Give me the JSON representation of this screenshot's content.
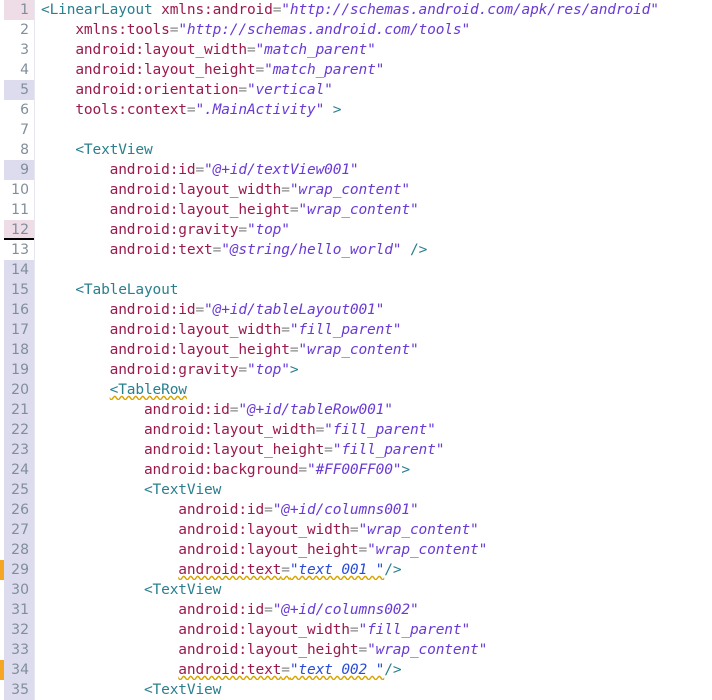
{
  "editor": {
    "kind": "xml-code-editor",
    "language": "android-xml-layout",
    "total_visible_lines": 35,
    "colors": {
      "background": "#ffffff",
      "tag": "#2a7f8f",
      "attribute": "#9b1a4e",
      "string": "#6a3bd4",
      "string_literal": "#2a4bd8",
      "equals": "#8a8a8a",
      "gutter_text": "#808e9b",
      "gutter_modified": "#dcdcee",
      "gutter_marked": "#eedce6",
      "warning_underline": "#d7a400",
      "warning_marker": "#f5a623",
      "caret_line_border": "#000000"
    }
  },
  "lines": [
    {
      "num": "1",
      "gutter": "marked",
      "marker": false,
      "indent": 0,
      "tokens": [
        {
          "type": "tag",
          "text": "<LinearLayout"
        },
        {
          "type": "plain",
          "text": " "
        },
        {
          "type": "attr",
          "text": "xmlns:android"
        },
        {
          "type": "eq",
          "text": "="
        },
        {
          "type": "str",
          "text": "\"http://schemas.android.com/apk/res/android\""
        }
      ]
    },
    {
      "num": "2",
      "gutter": "none",
      "marker": false,
      "indent": 4,
      "tokens": [
        {
          "type": "attr",
          "text": "xmlns:tools"
        },
        {
          "type": "eq",
          "text": "="
        },
        {
          "type": "str",
          "text": "\"http://schemas.android.com/tools\""
        }
      ]
    },
    {
      "num": "3",
      "gutter": "none",
      "marker": false,
      "indent": 4,
      "tokens": [
        {
          "type": "attr",
          "text": "android:layout_width"
        },
        {
          "type": "eq",
          "text": "="
        },
        {
          "type": "str",
          "text": "\"match_parent\""
        }
      ]
    },
    {
      "num": "4",
      "gutter": "none",
      "marker": false,
      "indent": 4,
      "tokens": [
        {
          "type": "attr",
          "text": "android:layout_height"
        },
        {
          "type": "eq",
          "text": "="
        },
        {
          "type": "str",
          "text": "\"match_parent\""
        }
      ]
    },
    {
      "num": "5",
      "gutter": "mod",
      "marker": false,
      "indent": 4,
      "tokens": [
        {
          "type": "attr",
          "text": "android:orientation"
        },
        {
          "type": "eq",
          "text": "="
        },
        {
          "type": "str",
          "text": "\"vertical\""
        }
      ]
    },
    {
      "num": "6",
      "gutter": "none",
      "marker": false,
      "indent": 4,
      "tokens": [
        {
          "type": "attr",
          "text": "tools:context"
        },
        {
          "type": "eq",
          "text": "="
        },
        {
          "type": "str",
          "text": "\".MainActivity\""
        },
        {
          "type": "plain",
          "text": " "
        },
        {
          "type": "tag",
          "text": ">"
        }
      ]
    },
    {
      "num": "7",
      "gutter": "none",
      "marker": false,
      "indent": 0,
      "tokens": []
    },
    {
      "num": "8",
      "gutter": "none",
      "marker": false,
      "indent": 4,
      "tokens": [
        {
          "type": "tag",
          "text": "<TextView"
        }
      ]
    },
    {
      "num": "9",
      "gutter": "mod",
      "marker": false,
      "indent": 8,
      "tokens": [
        {
          "type": "attr",
          "text": "android:id"
        },
        {
          "type": "eq",
          "text": "="
        },
        {
          "type": "str",
          "text": "\"@+id/textView001\""
        }
      ]
    },
    {
      "num": "10",
      "gutter": "none",
      "marker": false,
      "indent": 8,
      "tokens": [
        {
          "type": "attr",
          "text": "android:layout_width"
        },
        {
          "type": "eq",
          "text": "="
        },
        {
          "type": "str",
          "text": "\"wrap_content\""
        }
      ]
    },
    {
      "num": "11",
      "gutter": "none",
      "marker": false,
      "indent": 8,
      "tokens": [
        {
          "type": "attr",
          "text": "android:layout_height"
        },
        {
          "type": "eq",
          "text": "="
        },
        {
          "type": "str",
          "text": "\"wrap_content\""
        }
      ]
    },
    {
      "num": "12",
      "gutter": "marked",
      "caret": true,
      "marker": false,
      "indent": 8,
      "tokens": [
        {
          "type": "attr",
          "text": "android:gravity"
        },
        {
          "type": "eq",
          "text": "="
        },
        {
          "type": "str",
          "text": "\"top\""
        }
      ]
    },
    {
      "num": "13",
      "gutter": "none",
      "marker": false,
      "indent": 8,
      "tokens": [
        {
          "type": "attr",
          "text": "android:text"
        },
        {
          "type": "eq",
          "text": "="
        },
        {
          "type": "str",
          "text": "\"@string/hello_world\""
        },
        {
          "type": "plain",
          "text": " "
        },
        {
          "type": "tag",
          "text": "/>"
        }
      ]
    },
    {
      "num": "14",
      "gutter": "mod",
      "marker": false,
      "indent": 0,
      "tokens": []
    },
    {
      "num": "15",
      "gutter": "mod",
      "marker": false,
      "indent": 4,
      "tokens": [
        {
          "type": "tag",
          "text": "<TableLayout"
        }
      ]
    },
    {
      "num": "16",
      "gutter": "mod",
      "marker": false,
      "indent": 8,
      "tokens": [
        {
          "type": "attr",
          "text": "android:id"
        },
        {
          "type": "eq",
          "text": "="
        },
        {
          "type": "str",
          "text": "\"@+id/tableLayout001\""
        }
      ]
    },
    {
      "num": "17",
      "gutter": "mod",
      "marker": false,
      "indent": 8,
      "tokens": [
        {
          "type": "attr",
          "text": "android:layout_width"
        },
        {
          "type": "eq",
          "text": "="
        },
        {
          "type": "str",
          "text": "\"fill_parent\""
        }
      ]
    },
    {
      "num": "18",
      "gutter": "mod",
      "marker": false,
      "indent": 8,
      "tokens": [
        {
          "type": "attr",
          "text": "android:layout_height"
        },
        {
          "type": "eq",
          "text": "="
        },
        {
          "type": "str",
          "text": "\"wrap_content\""
        }
      ]
    },
    {
      "num": "19",
      "gutter": "mod",
      "marker": false,
      "indent": 8,
      "tokens": [
        {
          "type": "attr",
          "text": "android:gravity"
        },
        {
          "type": "eq",
          "text": "="
        },
        {
          "type": "str",
          "text": "\"top\""
        },
        {
          "type": "tag",
          "text": ">"
        }
      ]
    },
    {
      "num": "20",
      "gutter": "mod",
      "marker": false,
      "indent": 8,
      "tokens": [
        {
          "type": "tag-warn",
          "text": "<TableRow"
        }
      ]
    },
    {
      "num": "21",
      "gutter": "mod",
      "marker": false,
      "indent": 12,
      "tokens": [
        {
          "type": "attr",
          "text": "android:id"
        },
        {
          "type": "eq",
          "text": "="
        },
        {
          "type": "str",
          "text": "\"@+id/tableRow001\""
        }
      ]
    },
    {
      "num": "22",
      "gutter": "mod",
      "marker": false,
      "indent": 12,
      "tokens": [
        {
          "type": "attr",
          "text": "android:layout_width"
        },
        {
          "type": "eq",
          "text": "="
        },
        {
          "type": "str",
          "text": "\"fill_parent\""
        }
      ]
    },
    {
      "num": "23",
      "gutter": "mod",
      "marker": false,
      "indent": 12,
      "tokens": [
        {
          "type": "attr",
          "text": "android:layout_height"
        },
        {
          "type": "eq",
          "text": "="
        },
        {
          "type": "str",
          "text": "\"fill_parent\""
        }
      ]
    },
    {
      "num": "24",
      "gutter": "mod",
      "marker": false,
      "indent": 12,
      "tokens": [
        {
          "type": "attr",
          "text": "android:background"
        },
        {
          "type": "eq",
          "text": "="
        },
        {
          "type": "str",
          "text": "\"#FF00FF00\""
        },
        {
          "type": "tag",
          "text": ">"
        }
      ]
    },
    {
      "num": "25",
      "gutter": "mod",
      "marker": false,
      "indent": 12,
      "tokens": [
        {
          "type": "tag",
          "text": "<TextView"
        }
      ]
    },
    {
      "num": "26",
      "gutter": "mod",
      "marker": false,
      "indent": 16,
      "tokens": [
        {
          "type": "attr",
          "text": "android:id"
        },
        {
          "type": "eq",
          "text": "="
        },
        {
          "type": "str",
          "text": "\"@+id/columns001\""
        }
      ]
    },
    {
      "num": "27",
      "gutter": "mod",
      "marker": false,
      "indent": 16,
      "tokens": [
        {
          "type": "attr",
          "text": "android:layout_width"
        },
        {
          "type": "eq",
          "text": "="
        },
        {
          "type": "str",
          "text": "\"wrap_content\""
        }
      ]
    },
    {
      "num": "28",
      "gutter": "mod",
      "marker": false,
      "indent": 16,
      "tokens": [
        {
          "type": "attr",
          "text": "android:layout_height"
        },
        {
          "type": "eq",
          "text": "="
        },
        {
          "type": "str",
          "text": "\"wrap_content\""
        }
      ]
    },
    {
      "num": "29",
      "gutter": "mod",
      "marker": true,
      "indent": 16,
      "warnspan": true,
      "tokens": [
        {
          "type": "attr-warn",
          "text": "android:text"
        },
        {
          "type": "eq-warn",
          "text": "="
        },
        {
          "type": "str2-warn",
          "text": "\"text 001 \""
        },
        {
          "type": "tag",
          "text": "/>"
        }
      ]
    },
    {
      "num": "30",
      "gutter": "mod",
      "marker": false,
      "indent": 12,
      "tokens": [
        {
          "type": "tag",
          "text": "<TextView"
        }
      ]
    },
    {
      "num": "31",
      "gutter": "mod",
      "marker": false,
      "indent": 16,
      "tokens": [
        {
          "type": "attr",
          "text": "android:id"
        },
        {
          "type": "eq",
          "text": "="
        },
        {
          "type": "str",
          "text": "\"@+id/columns002\""
        }
      ]
    },
    {
      "num": "32",
      "gutter": "mod",
      "marker": false,
      "indent": 16,
      "tokens": [
        {
          "type": "attr",
          "text": "android:layout_width"
        },
        {
          "type": "eq",
          "text": "="
        },
        {
          "type": "str",
          "text": "\"fill_parent\""
        }
      ]
    },
    {
      "num": "33",
      "gutter": "mod",
      "marker": false,
      "indent": 16,
      "tokens": [
        {
          "type": "attr",
          "text": "android:layout_height"
        },
        {
          "type": "eq",
          "text": "="
        },
        {
          "type": "str",
          "text": "\"wrap_content\""
        }
      ]
    },
    {
      "num": "34",
      "gutter": "mod",
      "marker": true,
      "indent": 16,
      "warnspan": true,
      "tokens": [
        {
          "type": "attr-warn",
          "text": "android:text"
        },
        {
          "type": "eq-warn",
          "text": "="
        },
        {
          "type": "str2-warn",
          "text": "\"text 002 \""
        },
        {
          "type": "tag",
          "text": "/>"
        }
      ]
    },
    {
      "num": "35",
      "gutter": "mod",
      "marker": false,
      "indent": 12,
      "tokens": [
        {
          "type": "tag",
          "text": "<TextView"
        }
      ]
    }
  ]
}
